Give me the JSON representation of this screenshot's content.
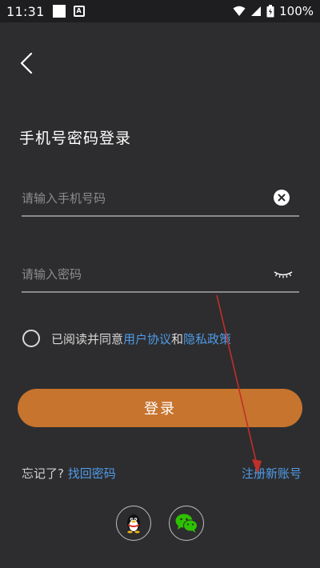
{
  "status_bar": {
    "time": "11:31",
    "battery": "100%",
    "icons": [
      "square-icon",
      "app-a-icon",
      "wifi-icon",
      "signal-icon",
      "battery-icon"
    ]
  },
  "header": {
    "back_icon": "chevron-left-icon",
    "title": "手机号密码登录"
  },
  "form": {
    "phone_placeholder": "请输入手机号码",
    "phone_value": "",
    "password_placeholder": "请输入密码",
    "password_value": "",
    "clear_icon": "close-circle-icon",
    "eye_icon": "eye-closed-icon"
  },
  "agreement": {
    "prefix": "已阅读并同意",
    "user_agreement": "用户协议",
    "and": "和",
    "privacy_policy": "隐私政策"
  },
  "login_button": "登录",
  "footer": {
    "forgot_prefix": "忘记了?",
    "recover_password": "找回密码",
    "register": "注册新账号"
  },
  "social": [
    {
      "name": "qq",
      "icon": "qq-penguin-icon"
    },
    {
      "name": "wechat",
      "icon": "wechat-icon"
    }
  ],
  "colors": {
    "background": "#2d2d2f",
    "accent": "#c7742e",
    "link": "#4f9be8",
    "annotation_arrow": "#c0302a"
  }
}
